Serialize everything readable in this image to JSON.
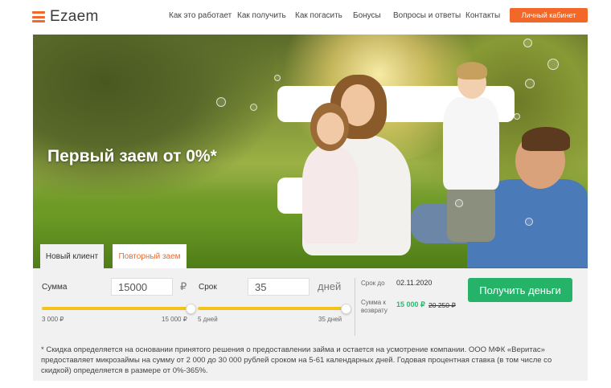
{
  "header": {
    "logo_text": "Ezaem",
    "nav": [
      "Как это работает",
      "Как получить",
      "Как погасить",
      "Бонусы",
      "Вопросы и ответы",
      "Контакты"
    ],
    "cabinet_label": "Личный кабинет"
  },
  "hero": {
    "title": "Первый заем от 0%*"
  },
  "tabs": {
    "new_client": "Новый клиент",
    "repeat_loan": "Повторный заем"
  },
  "calculator": {
    "sum_label": "Сумма",
    "sum_value": "15000",
    "sum_unit": "₽",
    "sum_min": "3 000 ₽",
    "sum_max": "15 000 ₽",
    "sum_fraction": 1.0,
    "term_label": "Срок",
    "term_value": "35",
    "term_unit": "дней",
    "term_min": "5 дней",
    "term_max": "35 дней",
    "term_fraction": 1.0,
    "due_label": "Срок до",
    "due_date": "02.11.2020",
    "return_label_1": "Сумма к",
    "return_label_2": "возврату",
    "return_amount": "15 000 ₽",
    "return_amount_old": "20 250 ₽",
    "get_money_label": "Получить деньги",
    "disclaimer": "* Скидка определяется на основании принятого решения о предоставлении займа и остается на усмотрение компании. ООО МФК «Веритас» предоставляет микрозаймы на сумму от 2 000 до 30 000 рублей сроком на 5-61 календарных дней. Годовая процентная ставка (в том числе со скидкой) определяется в размере от 0%-365%."
  },
  "colors": {
    "accent": "#f2672a",
    "slider": "#f3c21b",
    "cta": "#25b36a",
    "amount_green": "#2fb673"
  }
}
